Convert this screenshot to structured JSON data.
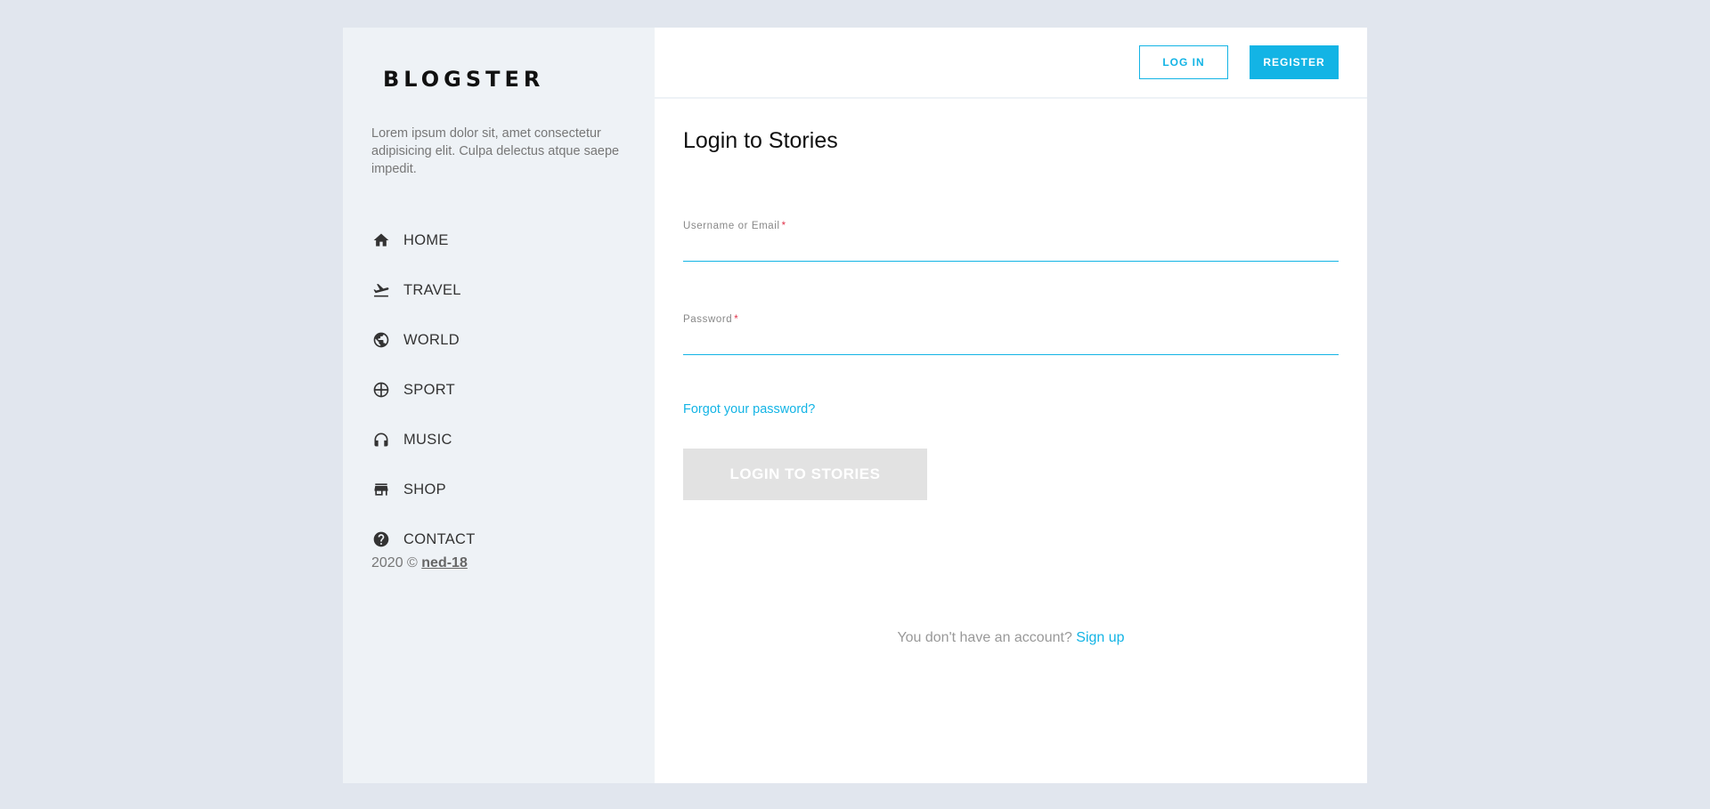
{
  "brand": {
    "logo_text": "BLOGSTER"
  },
  "sidebar": {
    "intro": "Lorem ipsum dolor sit, amet consectetur adipisicing elit. Culpa delectus atque saepe impedit.",
    "items": [
      {
        "label": "HOME",
        "icon": "home-icon"
      },
      {
        "label": "TRAVEL",
        "icon": "airplane-icon"
      },
      {
        "label": "WORLD",
        "icon": "globe-icon"
      },
      {
        "label": "SPORT",
        "icon": "ball-icon"
      },
      {
        "label": "MUSIC",
        "icon": "headphones-icon"
      },
      {
        "label": "SHOP",
        "icon": "store-icon"
      },
      {
        "label": "CONTACT",
        "icon": "help-icon"
      }
    ],
    "copyright_prefix": "2020 ©",
    "copyright_link": "ned-18"
  },
  "header": {
    "login_label": "LOG IN",
    "register_label": "REGISTER"
  },
  "form": {
    "title": "Login to Stories",
    "username_label": "Username or Email",
    "username_value": "",
    "password_label": "Password",
    "password_value": "",
    "required_mark": "*",
    "forgot_label": "Forgot your password?",
    "submit_label": "LOGIN TO STORIES",
    "signup_prompt": "You don't have an account?",
    "signup_link": "Sign up"
  },
  "colors": {
    "accent": "#13b4e5",
    "page_bg": "#e1e6ee",
    "sidebar_bg": "#eef2f6",
    "required": "#e0334a",
    "disabled_button": "#e2e2e2"
  }
}
